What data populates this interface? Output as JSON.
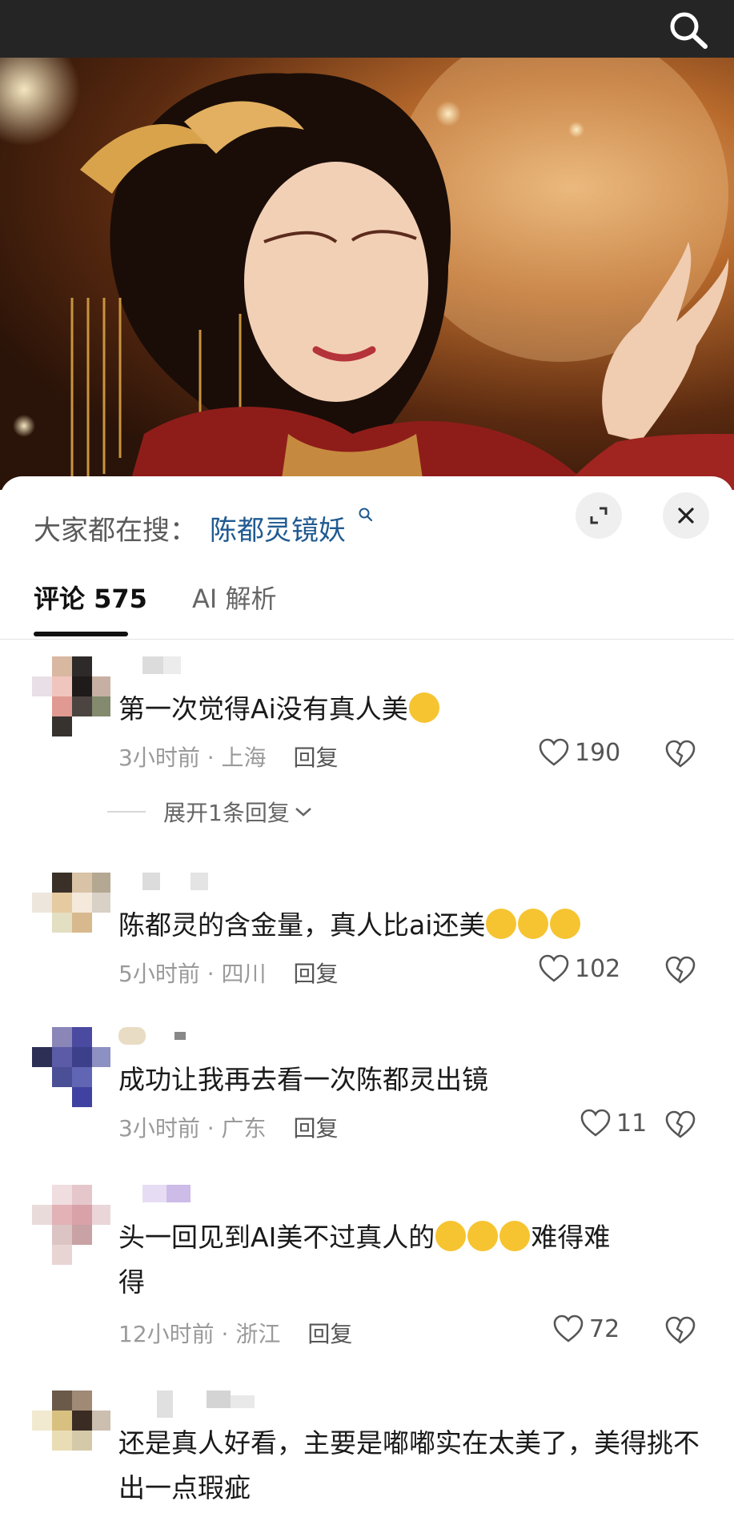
{
  "hot_search": {
    "label": "大家都在搜：",
    "term": "陈都灵镜妖"
  },
  "tabs": {
    "comments": "评论 575",
    "ai": "AI 解析"
  },
  "comments": [
    {
      "text": "第一次觉得Ai没有真人美",
      "emoji": [
        "crying-face"
      ],
      "time": "3小时前 · 上海",
      "reply": "回复",
      "likes": "190",
      "expand": "展开1条回复"
    },
    {
      "text": "陈都灵的含金量，真人比ai还美",
      "emoji": [
        "heart-eyes-face",
        "heart-eyes-face",
        "heart-eyes-face"
      ],
      "time": "5小时前 · 四川",
      "reply": "回复",
      "likes": "102"
    },
    {
      "text": "成功让我再去看一次陈都灵出镜",
      "emoji": [],
      "time": "3小时前 · 广东",
      "reply": "回复",
      "likes": "11"
    },
    {
      "text_a": "头一回见到AI美不过真人的",
      "text_b": "难得难",
      "text_c": "得",
      "emoji": [
        "rolling-laughing-face",
        "rolling-laughing-face",
        "rolling-laughing-face"
      ],
      "time": "12小时前 · 浙江",
      "reply": "回复",
      "likes": "72"
    },
    {
      "text": "还是真人好看，主要是嘟嘟实在太美了，美得挑不出一点瑕疵",
      "emoji": []
    }
  ],
  "colors": {
    "topbar": "#252525",
    "link": "#1f5a91",
    "meta": "#9a9a9a"
  }
}
